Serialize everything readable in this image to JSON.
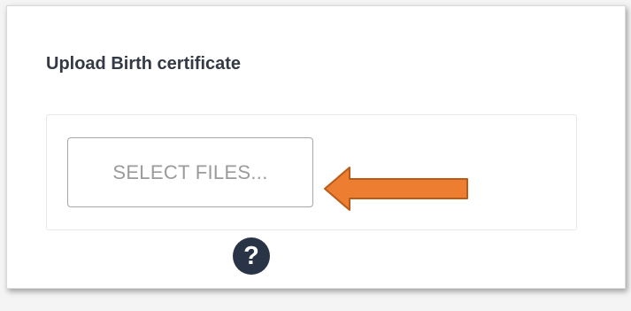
{
  "upload": {
    "label": "Upload Birth certificate",
    "select_button_label": "SELECT FILES...",
    "help_icon_glyph": "?"
  },
  "annotation": {
    "arrow_color": "#ed7d31",
    "arrow_direction": "left"
  },
  "colors": {
    "label_text": "#333a45",
    "button_text": "#9b9b9b",
    "help_icon_bg": "#2a3447"
  }
}
